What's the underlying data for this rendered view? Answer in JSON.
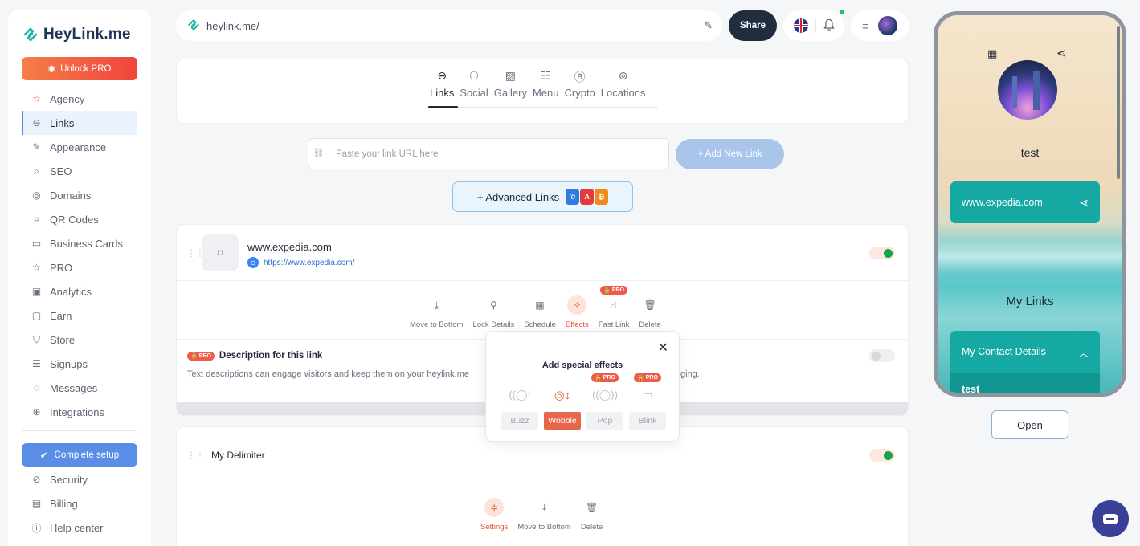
{
  "brand": {
    "name": "HeyLink.me",
    "accent": "#1d3557",
    "teal": "#1fb5a8"
  },
  "sidebar": {
    "unlock_label": "Unlock PRO",
    "items": [
      {
        "label": "Agency",
        "icon": "star-icon"
      },
      {
        "label": "Links",
        "icon": "link-icon",
        "active": true
      },
      {
        "label": "Appearance",
        "icon": "palette-icon"
      },
      {
        "label": "SEO",
        "icon": "search-icon"
      },
      {
        "label": "Domains",
        "icon": "globe-icon"
      },
      {
        "label": "QR Codes",
        "icon": "qr-icon"
      },
      {
        "label": "Business Cards",
        "icon": "card-icon"
      },
      {
        "label": "PRO",
        "icon": "star-icon"
      },
      {
        "label": "Analytics",
        "icon": "analytics-icon"
      },
      {
        "label": "Earn",
        "icon": "wallet-icon"
      },
      {
        "label": "Store",
        "icon": "cart-icon"
      },
      {
        "label": "Signups",
        "icon": "list-icon"
      },
      {
        "label": "Messages",
        "icon": "message-icon"
      },
      {
        "label": "Integrations",
        "icon": "integrations-icon"
      }
    ],
    "complete_label": "Complete setup",
    "bottom_items": [
      {
        "label": "Security",
        "icon": "shield-icon"
      },
      {
        "label": "Billing",
        "icon": "billing-icon"
      },
      {
        "label": "Help center",
        "icon": "help-icon"
      }
    ]
  },
  "topbar": {
    "url": "heylink.me/",
    "share_label": "Share"
  },
  "tabs": [
    {
      "label": "Links",
      "active": true
    },
    {
      "label": "Social"
    },
    {
      "label": "Gallery"
    },
    {
      "label": "Menu"
    },
    {
      "label": "Crypto"
    },
    {
      "label": "Locations"
    }
  ],
  "add_link": {
    "placeholder": "Paste your link URL here",
    "button_label": "+ Add New Link",
    "advanced_label": "+ Advanced Links"
  },
  "link_card": {
    "title": "www.expedia.com",
    "url": "https://www.expedia.com/",
    "enabled": true,
    "actions": [
      "Move to Bottom",
      "Lock Details",
      "Schedule",
      "Effects",
      "Fast Link",
      "Delete"
    ],
    "pro_label": "PRO",
    "description_title": "Description for this link",
    "description_text": "Text descriptions can engage visitors and keep them on your heylink.me",
    "description_text_tail": "ging.",
    "description_enabled": false
  },
  "effects_popup": {
    "title": "Add special effects",
    "options": [
      {
        "label": "Buzz",
        "selected": false,
        "pro": false
      },
      {
        "label": "Wobble",
        "selected": true,
        "pro": false
      },
      {
        "label": "Pop",
        "selected": false,
        "pro": true
      },
      {
        "label": "Blink",
        "selected": false,
        "pro": true
      }
    ]
  },
  "delimiter_card": {
    "title": "My Delimiter",
    "enabled": true,
    "actions": [
      "Settings",
      "Move to Bottom",
      "Delete"
    ]
  },
  "preview": {
    "name": "test",
    "link_label": "www.expedia.com",
    "section_title": "My Links",
    "contact_label": "My Contact Details",
    "contact_body": "test",
    "open_label": "Open"
  }
}
